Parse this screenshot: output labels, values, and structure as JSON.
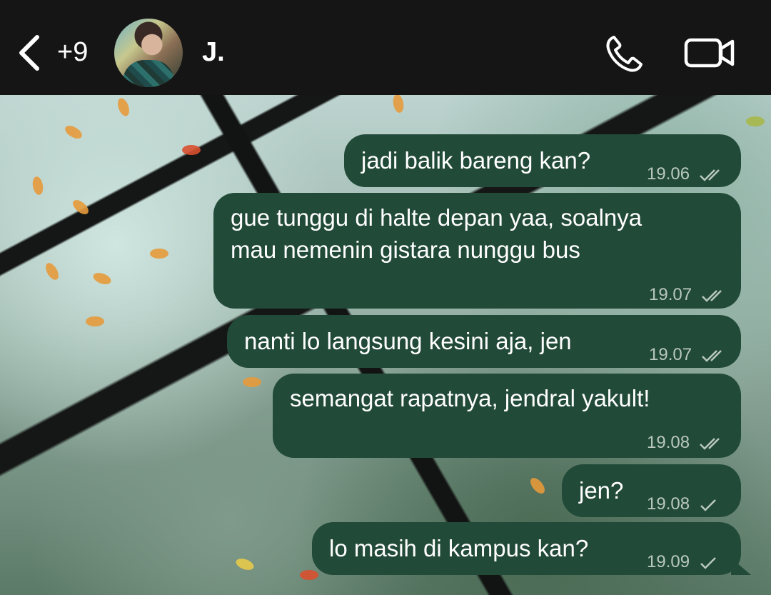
{
  "header": {
    "back_count": "+9",
    "contact_name": "J."
  },
  "icons": {
    "back": "chevron-left-icon",
    "phone": "phone-icon",
    "video": "video-camera-icon"
  },
  "colors": {
    "header_bg": "#151515",
    "bubble_bg": "#224a38",
    "meta_text": "#b9c8c0"
  },
  "messages": [
    {
      "text": "jadi balik bareng kan?",
      "time": "19.06",
      "status": "read"
    },
    {
      "text": "gue tunggu di halte depan yaa, soalnya",
      "text2": "mau nemenin gistara nunggu bus",
      "time": "19.07",
      "status": "read"
    },
    {
      "text": "nanti lo langsung kesini aja, jen",
      "time": "19.07",
      "status": "read"
    },
    {
      "text": "semangat rapatnya, jendral yakult!",
      "time": "19.08",
      "status": "read"
    },
    {
      "text": "jen?",
      "time": "19.08",
      "status": "sent"
    },
    {
      "text": "lo masih di kampus kan?",
      "time": "19.09",
      "status": "sent"
    }
  ]
}
